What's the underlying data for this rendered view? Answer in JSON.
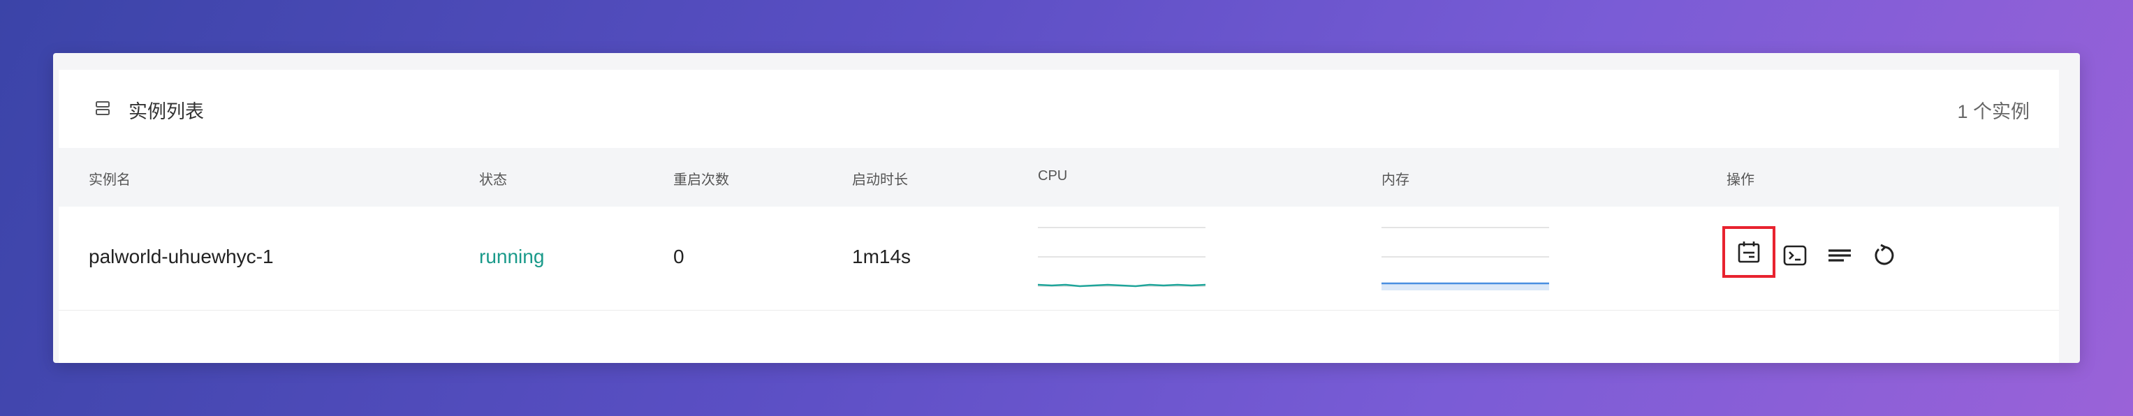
{
  "card": {
    "title": "实例列表",
    "count_label": "1 个实例"
  },
  "table": {
    "columns": [
      "实例名",
      "状态",
      "重启次数",
      "启动时长",
      "CPU",
      "内存",
      "操作"
    ],
    "rows": [
      {
        "name": "palworld-uhuewhyc-1",
        "status": "running",
        "restarts": "0",
        "uptime": "1m14s"
      }
    ]
  },
  "colors": {
    "status_running": "#1a9a8a",
    "cpu_line": "#1fa59a",
    "mem_line": "#4a8fe0",
    "highlight": "#e8232f"
  },
  "icons": [
    "list-icon",
    "calendar-icon",
    "terminal-icon",
    "logs-icon",
    "restart-icon"
  ]
}
